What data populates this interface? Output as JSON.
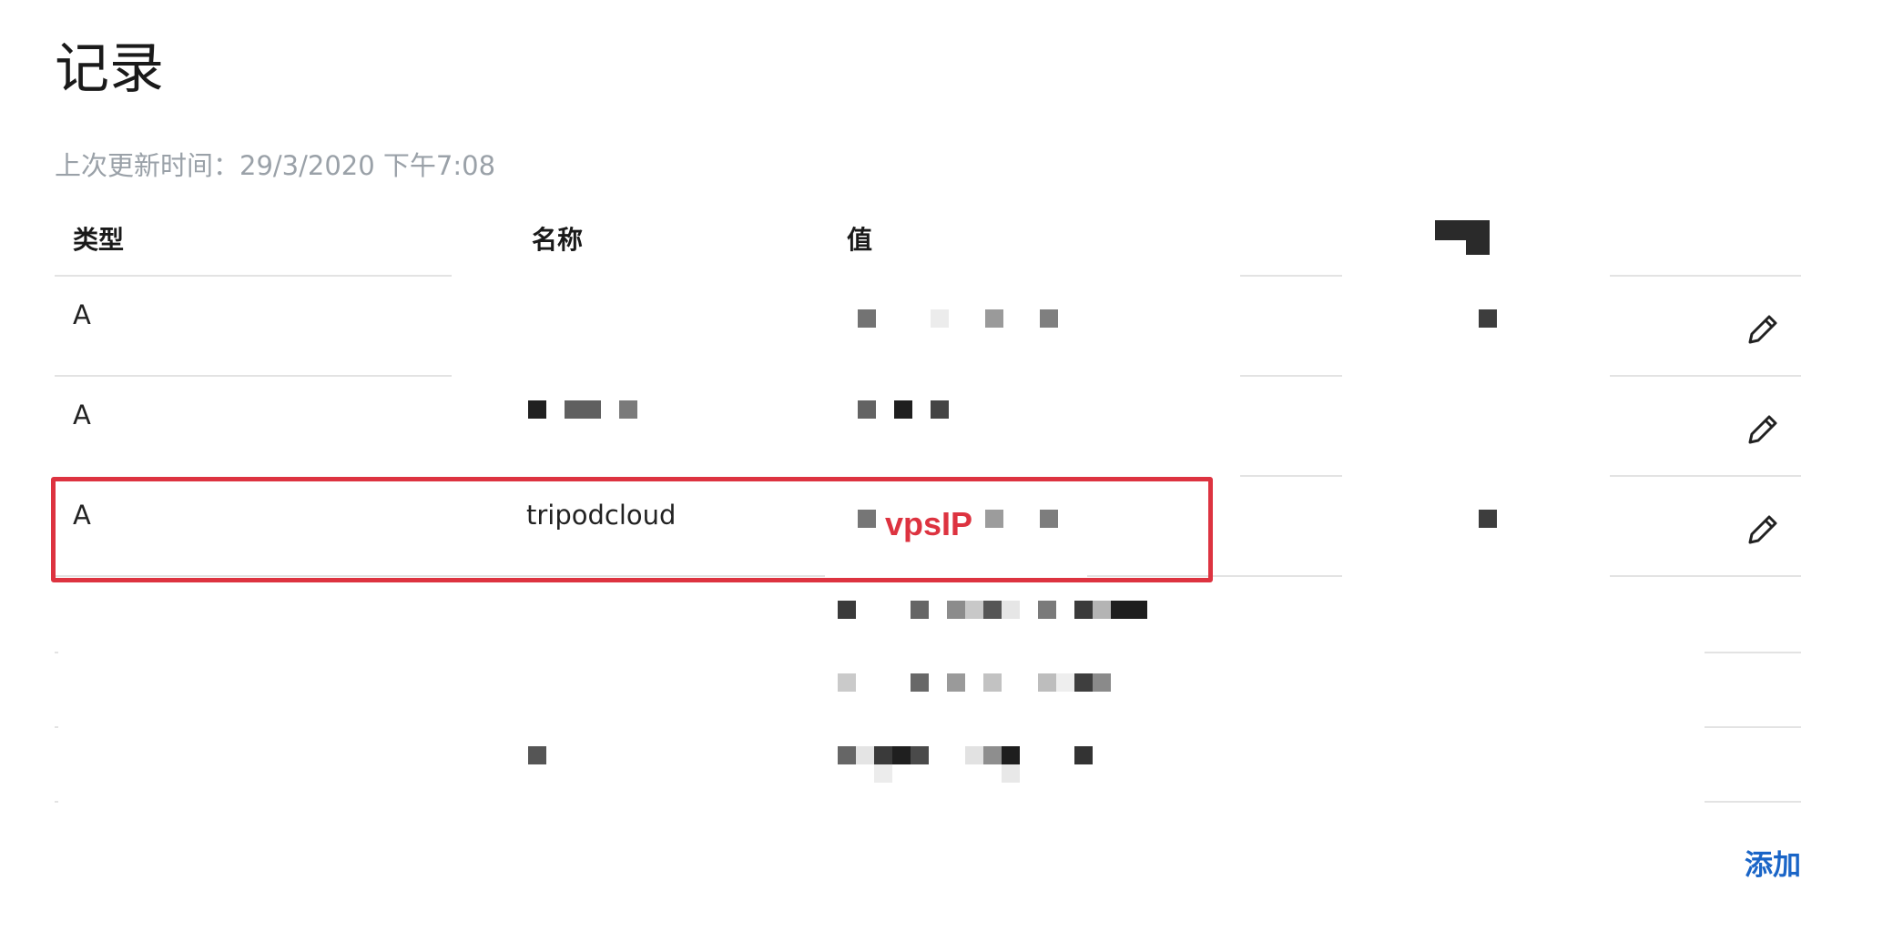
{
  "page": {
    "title": "记录",
    "updated_text": "上次更新时间：29/3/2020 下午7:08"
  },
  "table": {
    "headers": {
      "type": "类型",
      "name": "名称",
      "value": "值"
    },
    "rows": [
      {
        "type": "A",
        "name": "",
        "value": ""
      },
      {
        "type": "A",
        "name": "",
        "value": ""
      },
      {
        "type": "A",
        "name": "tripodcloud",
        "value": ""
      },
      {
        "type": "",
        "name": "",
        "value": ""
      },
      {
        "type": "",
        "name": "",
        "value": ""
      },
      {
        "type": "",
        "name": "",
        "value": ""
      }
    ]
  },
  "annotation": {
    "label": "vpsIP",
    "color": "#dd3340"
  },
  "actions": {
    "add_label": "添加",
    "link_color": "#1a65c7"
  },
  "icons": {
    "edit": "pencil-icon"
  }
}
